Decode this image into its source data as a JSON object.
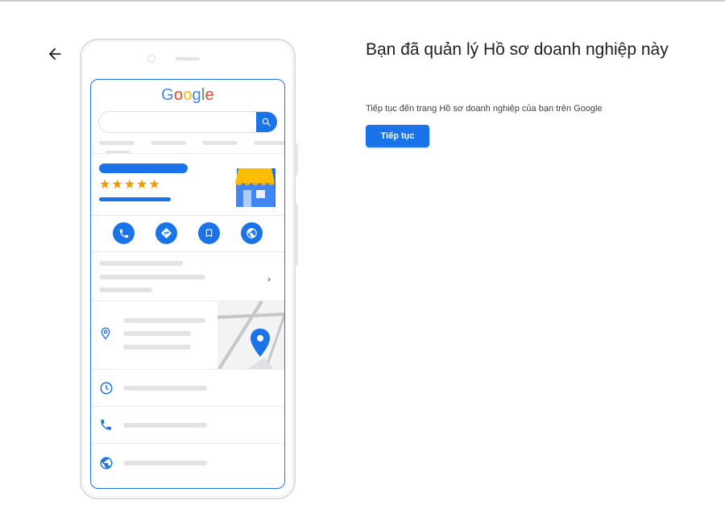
{
  "header": {
    "back_icon": "arrow-back-icon"
  },
  "illustration": {
    "logo_letters": [
      "G",
      "o",
      "o",
      "g",
      "l",
      "e"
    ],
    "rating_stars": "★★★★★",
    "accent_color": "#1a73e8",
    "star_color": "#f29900",
    "action_icons": [
      "phone-icon",
      "directions-icon",
      "bookmark-icon",
      "globe-icon"
    ],
    "row_icons": [
      "location-pin-icon",
      "clock-icon",
      "phone-icon",
      "globe-icon"
    ]
  },
  "main": {
    "title": "Bạn đã quản lý Hồ sơ doanh nghiệp này",
    "subtitle": "Tiếp tục đến trang Hồ sơ doanh nghiệp của bạn trên Google",
    "continue_label": "Tiếp tục",
    "button_color": "#1a73e8"
  }
}
